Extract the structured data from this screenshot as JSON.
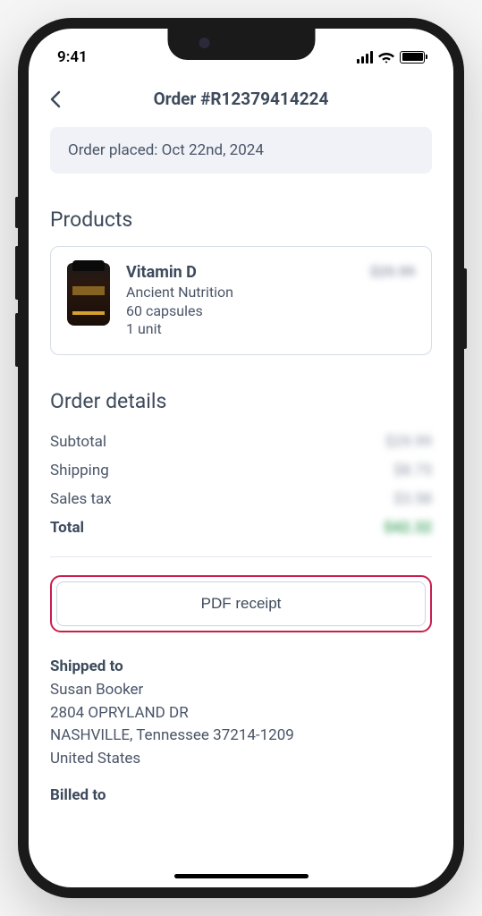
{
  "status_bar": {
    "time": "9:41"
  },
  "header": {
    "title": "Order #R12379414224"
  },
  "order_placed": "Order placed: Oct 22nd, 2024",
  "sections": {
    "products_heading": "Products",
    "order_details_heading": "Order details"
  },
  "products": [
    {
      "name": "Vitamin D",
      "brand": "Ancient Nutrition",
      "size": "60 capsules",
      "quantity": "1 unit",
      "price": "$29.99"
    }
  ],
  "order_details": {
    "subtotal_label": "Subtotal",
    "subtotal_value": "$29.99",
    "shipping_label": "Shipping",
    "shipping_value": "$8.75",
    "tax_label": "Sales tax",
    "tax_value": "$3.58",
    "total_label": "Total",
    "total_value": "$42.32"
  },
  "pdf_button_label": "PDF receipt",
  "shipped_to": {
    "heading": "Shipped to",
    "name": "Susan Booker",
    "street": "2804 OPRYLAND DR",
    "city_state_zip": "NASHVILLE, Tennessee 37214-1209",
    "country": "United States"
  },
  "billed_to": {
    "heading": "Billed to"
  }
}
